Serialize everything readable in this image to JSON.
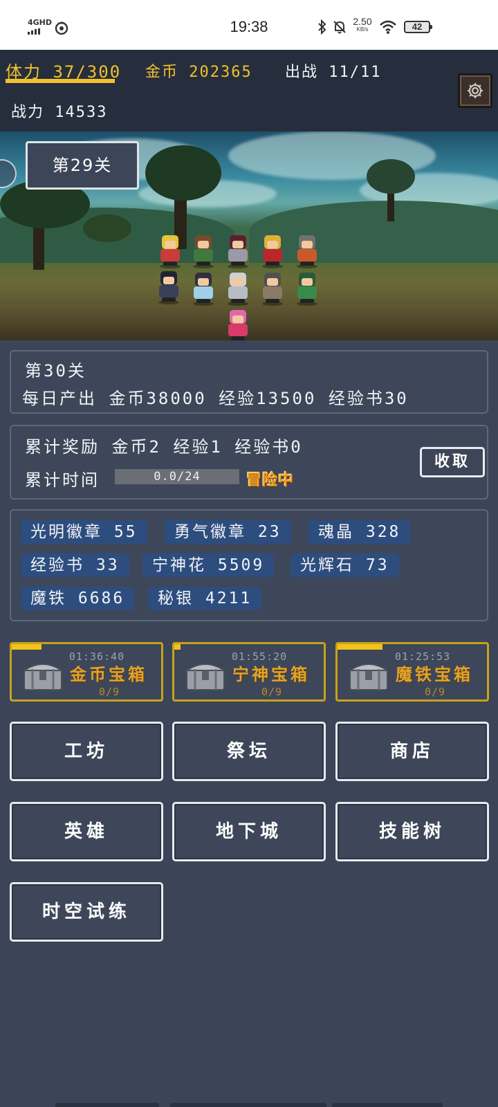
{
  "status_bar": {
    "network": "4GHD",
    "time": "19:38",
    "speed_value": "2.50",
    "speed_unit": "KB/s",
    "battery": "42"
  },
  "header": {
    "stamina": "体力 37/300",
    "stamina_fraction": 0.12,
    "gold": "金币 202365",
    "deploy": "出战 11/11",
    "power": "战力 14533",
    "settings_icon": "gear-icon"
  },
  "scene": {
    "current_stage": "第29关"
  },
  "next_stage": {
    "title": "第30关",
    "daily_output": "每日产出 金币38000 经验13500 经验书30"
  },
  "accumulated": {
    "rewards": "累计奖励 金币2 经验1 经验书0",
    "time_label": "累计时间",
    "progress_text": "0.0/24",
    "progress_value": 0,
    "status_tag": "冒险中",
    "collect_label": "收取"
  },
  "resources": [
    {
      "label": "光明徽章 55"
    },
    {
      "label": "勇气徽章 23"
    },
    {
      "label": "魂晶 328"
    },
    {
      "label": "经验书 33"
    },
    {
      "label": "宁神花 5509"
    },
    {
      "label": "光辉石 73"
    },
    {
      "label": "魔铁 6686"
    },
    {
      "label": "秘银 4211"
    }
  ],
  "chests": [
    {
      "name": "金币宝箱",
      "timer": "01:36:40",
      "count": "0/9",
      "fill": 0.2
    },
    {
      "name": "宁神宝箱",
      "timer": "01:55:20",
      "count": "0/9",
      "fill": 0.04
    },
    {
      "name": "魔铁宝箱",
      "timer": "01:25:53",
      "count": "0/9",
      "fill": 0.3
    }
  ],
  "menu": [
    {
      "label": "工坊"
    },
    {
      "label": "祭坛"
    },
    {
      "label": "商店"
    },
    {
      "label": "英雄"
    },
    {
      "label": "地下城"
    },
    {
      "label": "技能树"
    },
    {
      "label": "时空试练"
    }
  ],
  "colors": {
    "accent_gold": "#f2c12e",
    "panel_bg": "#3d4759",
    "chip_bg": "#2d4d7e",
    "chest_border": "#c8a21c"
  }
}
